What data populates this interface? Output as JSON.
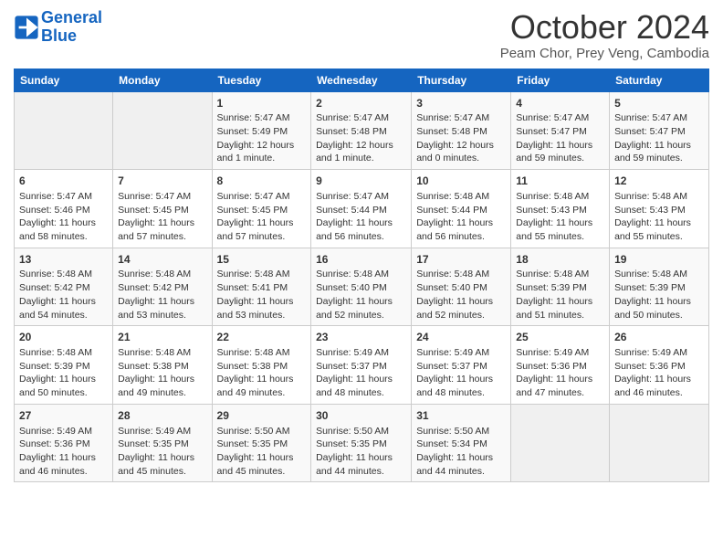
{
  "header": {
    "logo_line1": "General",
    "logo_line2": "Blue",
    "month_title": "October 2024",
    "location": "Peam Chor, Prey Veng, Cambodia"
  },
  "days_of_week": [
    "Sunday",
    "Monday",
    "Tuesday",
    "Wednesday",
    "Thursday",
    "Friday",
    "Saturday"
  ],
  "weeks": [
    [
      {
        "day": "",
        "content": ""
      },
      {
        "day": "",
        "content": ""
      },
      {
        "day": "1",
        "content": "Sunrise: 5:47 AM\nSunset: 5:49 PM\nDaylight: 12 hours and 1 minute."
      },
      {
        "day": "2",
        "content": "Sunrise: 5:47 AM\nSunset: 5:48 PM\nDaylight: 12 hours and 1 minute."
      },
      {
        "day": "3",
        "content": "Sunrise: 5:47 AM\nSunset: 5:48 PM\nDaylight: 12 hours and 0 minutes."
      },
      {
        "day": "4",
        "content": "Sunrise: 5:47 AM\nSunset: 5:47 PM\nDaylight: 11 hours and 59 minutes."
      },
      {
        "day": "5",
        "content": "Sunrise: 5:47 AM\nSunset: 5:47 PM\nDaylight: 11 hours and 59 minutes."
      }
    ],
    [
      {
        "day": "6",
        "content": "Sunrise: 5:47 AM\nSunset: 5:46 PM\nDaylight: 11 hours and 58 minutes."
      },
      {
        "day": "7",
        "content": "Sunrise: 5:47 AM\nSunset: 5:45 PM\nDaylight: 11 hours and 57 minutes."
      },
      {
        "day": "8",
        "content": "Sunrise: 5:47 AM\nSunset: 5:45 PM\nDaylight: 11 hours and 57 minutes."
      },
      {
        "day": "9",
        "content": "Sunrise: 5:47 AM\nSunset: 5:44 PM\nDaylight: 11 hours and 56 minutes."
      },
      {
        "day": "10",
        "content": "Sunrise: 5:48 AM\nSunset: 5:44 PM\nDaylight: 11 hours and 56 minutes."
      },
      {
        "day": "11",
        "content": "Sunrise: 5:48 AM\nSunset: 5:43 PM\nDaylight: 11 hours and 55 minutes."
      },
      {
        "day": "12",
        "content": "Sunrise: 5:48 AM\nSunset: 5:43 PM\nDaylight: 11 hours and 55 minutes."
      }
    ],
    [
      {
        "day": "13",
        "content": "Sunrise: 5:48 AM\nSunset: 5:42 PM\nDaylight: 11 hours and 54 minutes."
      },
      {
        "day": "14",
        "content": "Sunrise: 5:48 AM\nSunset: 5:42 PM\nDaylight: 11 hours and 53 minutes."
      },
      {
        "day": "15",
        "content": "Sunrise: 5:48 AM\nSunset: 5:41 PM\nDaylight: 11 hours and 53 minutes."
      },
      {
        "day": "16",
        "content": "Sunrise: 5:48 AM\nSunset: 5:40 PM\nDaylight: 11 hours and 52 minutes."
      },
      {
        "day": "17",
        "content": "Sunrise: 5:48 AM\nSunset: 5:40 PM\nDaylight: 11 hours and 52 minutes."
      },
      {
        "day": "18",
        "content": "Sunrise: 5:48 AM\nSunset: 5:39 PM\nDaylight: 11 hours and 51 minutes."
      },
      {
        "day": "19",
        "content": "Sunrise: 5:48 AM\nSunset: 5:39 PM\nDaylight: 11 hours and 50 minutes."
      }
    ],
    [
      {
        "day": "20",
        "content": "Sunrise: 5:48 AM\nSunset: 5:39 PM\nDaylight: 11 hours and 50 minutes."
      },
      {
        "day": "21",
        "content": "Sunrise: 5:48 AM\nSunset: 5:38 PM\nDaylight: 11 hours and 49 minutes."
      },
      {
        "day": "22",
        "content": "Sunrise: 5:48 AM\nSunset: 5:38 PM\nDaylight: 11 hours and 49 minutes."
      },
      {
        "day": "23",
        "content": "Sunrise: 5:49 AM\nSunset: 5:37 PM\nDaylight: 11 hours and 48 minutes."
      },
      {
        "day": "24",
        "content": "Sunrise: 5:49 AM\nSunset: 5:37 PM\nDaylight: 11 hours and 48 minutes."
      },
      {
        "day": "25",
        "content": "Sunrise: 5:49 AM\nSunset: 5:36 PM\nDaylight: 11 hours and 47 minutes."
      },
      {
        "day": "26",
        "content": "Sunrise: 5:49 AM\nSunset: 5:36 PM\nDaylight: 11 hours and 46 minutes."
      }
    ],
    [
      {
        "day": "27",
        "content": "Sunrise: 5:49 AM\nSunset: 5:36 PM\nDaylight: 11 hours and 46 minutes."
      },
      {
        "day": "28",
        "content": "Sunrise: 5:49 AM\nSunset: 5:35 PM\nDaylight: 11 hours and 45 minutes."
      },
      {
        "day": "29",
        "content": "Sunrise: 5:50 AM\nSunset: 5:35 PM\nDaylight: 11 hours and 45 minutes."
      },
      {
        "day": "30",
        "content": "Sunrise: 5:50 AM\nSunset: 5:35 PM\nDaylight: 11 hours and 44 minutes."
      },
      {
        "day": "31",
        "content": "Sunrise: 5:50 AM\nSunset: 5:34 PM\nDaylight: 11 hours and 44 minutes."
      },
      {
        "day": "",
        "content": ""
      },
      {
        "day": "",
        "content": ""
      }
    ]
  ]
}
